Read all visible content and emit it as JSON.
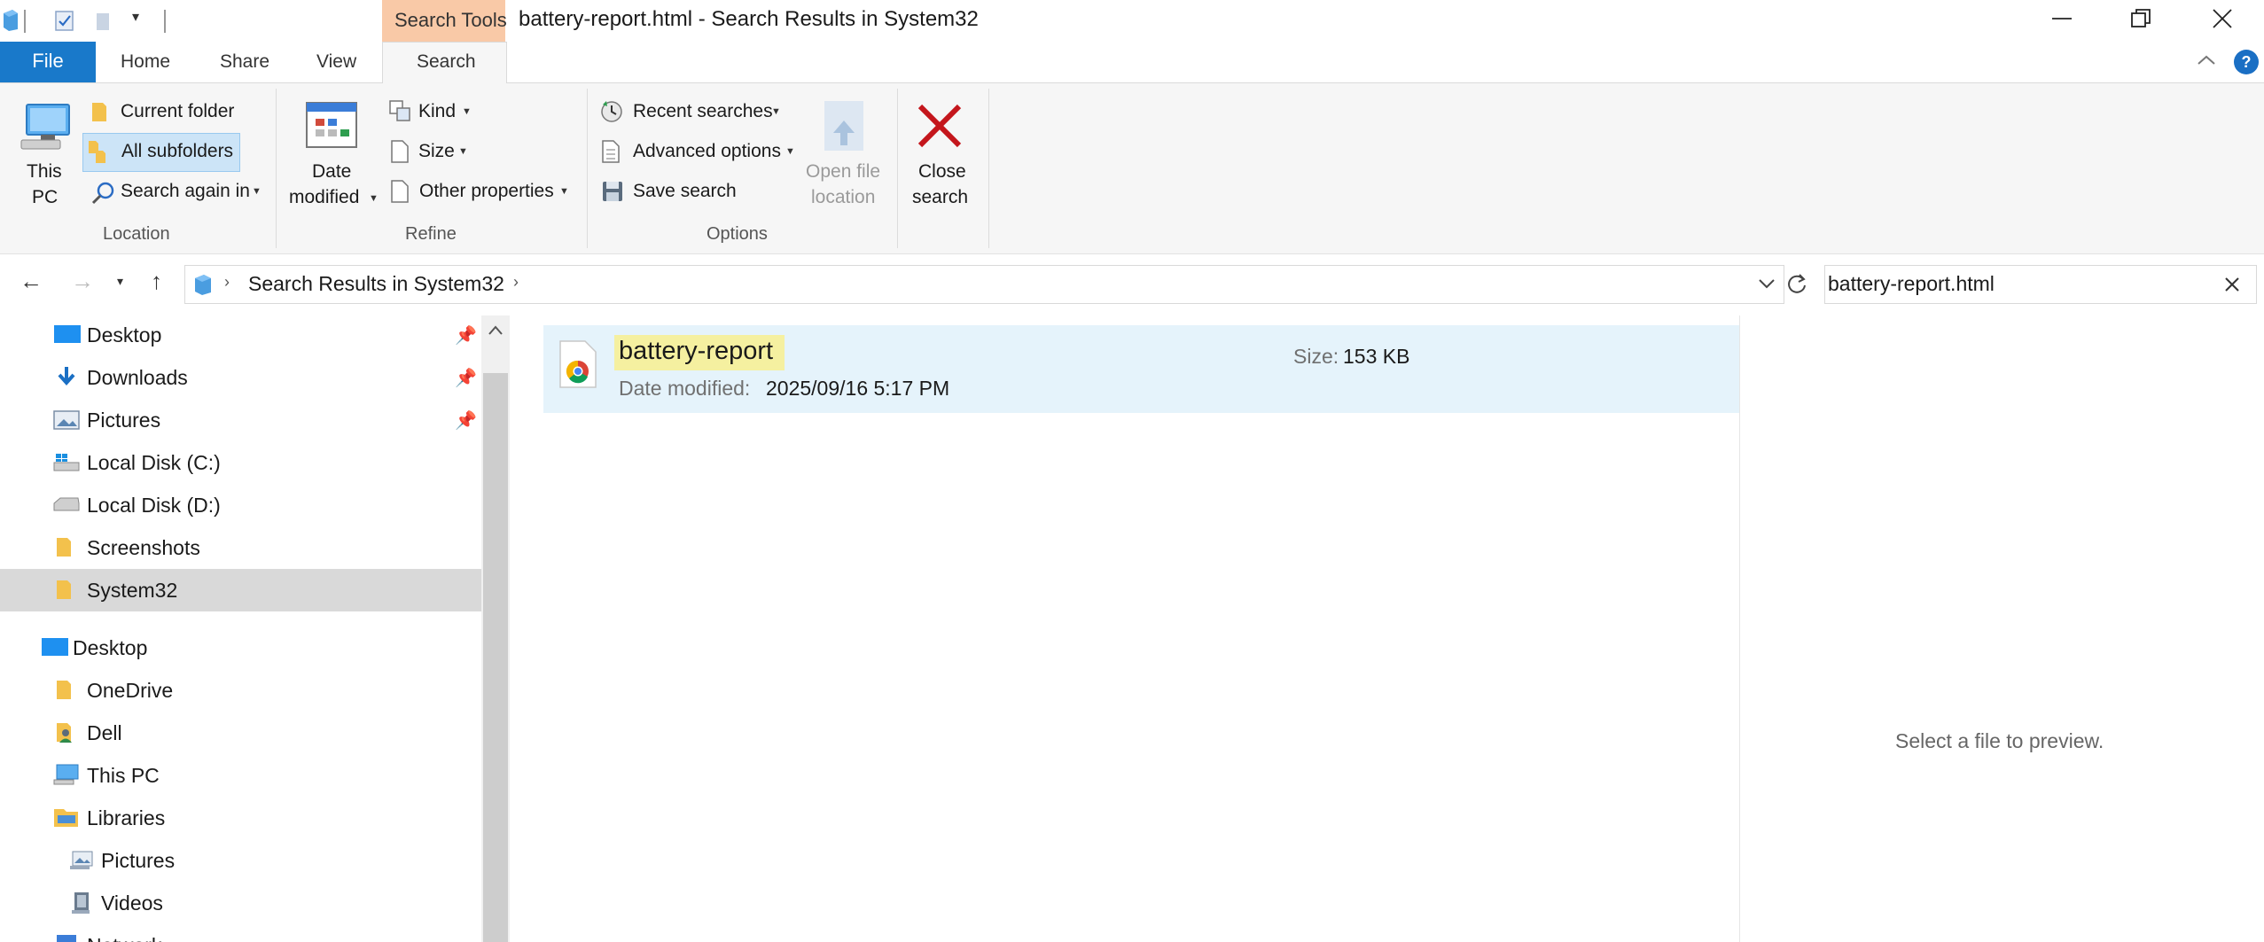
{
  "window": {
    "title": "battery-report.html - Search Results in System32",
    "context_tab": "Search Tools"
  },
  "tabs": {
    "file": "File",
    "home": "Home",
    "share": "Share",
    "view": "View",
    "search": "Search"
  },
  "ribbon": {
    "location": {
      "this_pc_line1": "This",
      "this_pc_line2": "PC",
      "current_folder": "Current folder",
      "all_subfolders": "All subfolders",
      "search_again_in": "Search again in",
      "group_label": "Location"
    },
    "refine": {
      "date_modified_line1": "Date",
      "date_modified_line2": "modified",
      "kind": "Kind",
      "size": "Size",
      "other_properties": "Other properties",
      "group_label": "Refine"
    },
    "options": {
      "recent_searches": "Recent searches",
      "advanced_options": "Advanced options",
      "save_search": "Save search",
      "open_file_location_line1": "Open file",
      "open_file_location_line2": "location",
      "group_label": "Options"
    },
    "close": {
      "line1": "Close",
      "line2": "search"
    }
  },
  "address": {
    "breadcrumb": "Search Results in System32",
    "search_value": "battery-report.html"
  },
  "nav": {
    "quick_access": [
      {
        "label": "Desktop"
      },
      {
        "label": "Downloads"
      },
      {
        "label": "Pictures"
      },
      {
        "label": "Local Disk (C:)"
      },
      {
        "label": "Local Disk (D:)"
      },
      {
        "label": "Screenshots"
      },
      {
        "label": "System32"
      }
    ],
    "desktop_tree": [
      {
        "label": "Desktop"
      },
      {
        "label": "OneDrive"
      },
      {
        "label": "Dell"
      },
      {
        "label": "This PC"
      },
      {
        "label": "Libraries"
      },
      {
        "label": "Pictures"
      },
      {
        "label": "Videos"
      },
      {
        "label": "Network"
      }
    ]
  },
  "results": [
    {
      "name": "battery-report",
      "date_label": "Date modified:",
      "date_value": "2025/09/16 5:17 PM",
      "size_label": "Size:",
      "size_value": "153 KB"
    }
  ],
  "preview": {
    "message": "Select a file to preview."
  },
  "colors": {
    "file_tab": "#1979ca",
    "search_tools": "#f9c9a7",
    "selection": "#e5f3fb",
    "highlight": "#f5f0a0"
  }
}
